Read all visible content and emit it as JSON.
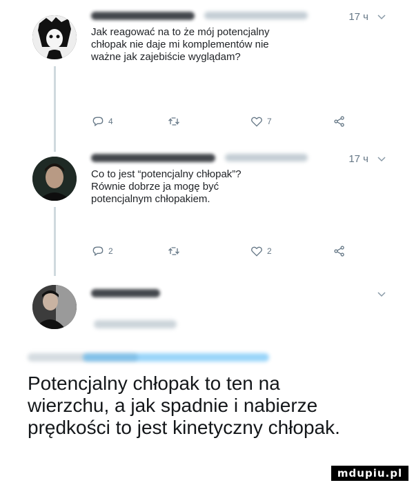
{
  "tweets": [
    {
      "time": "17 ч",
      "text": "Jak reagować na to że mój potencjalny\nchłopak nie daje mi komplementów nie\nważne jak zajebiście wyglądam?",
      "replies": "4",
      "retweets": "",
      "likes": "7"
    },
    {
      "time": "17 ч",
      "text": "Co to jest “potencjalny chłopak”?\nRównie dobrze ja mogę być\npotencjalnym chłopakiem.",
      "replies": "2",
      "retweets": "",
      "likes": "2"
    }
  ],
  "headline": "Potencjalny chłopak to ten na\nwierzchu, a jak spadnie i nabierze\nprędkości to jest kinetyczny chłopak.",
  "watermark": "mdupiu.pl",
  "icons": [
    "reply-icon",
    "retweet-icon",
    "like-icon",
    "share-icon",
    "chevron-down-icon"
  ],
  "colors": {
    "accent": "#1da1f2",
    "muted": "#657786",
    "thread": "#cfd9de"
  }
}
